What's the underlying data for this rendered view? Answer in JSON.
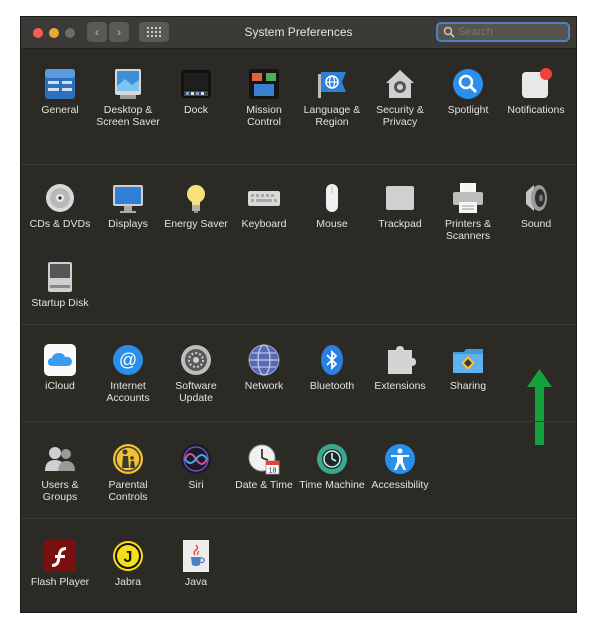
{
  "window": {
    "title": "System Preferences"
  },
  "search": {
    "placeholder": "Search"
  },
  "colors": {
    "accent": "#4b82c4",
    "arrow": "#14a03c",
    "bg": "#2c2a25"
  },
  "sections": [
    {
      "items": [
        {
          "label": "General",
          "icon": "general-icon"
        },
        {
          "label": "Desktop & Screen Saver",
          "icon": "desktop-icon"
        },
        {
          "label": "Dock",
          "icon": "dock-icon"
        },
        {
          "label": "Mission Control",
          "icon": "mission-control-icon"
        },
        {
          "label": "Language & Region",
          "icon": "language-icon"
        },
        {
          "label": "Security & Privacy",
          "icon": "security-icon"
        },
        {
          "label": "Spotlight",
          "icon": "spotlight-icon"
        },
        {
          "label": "Notifications",
          "icon": "notifications-icon"
        }
      ]
    },
    {
      "items": [
        {
          "label": "CDs & DVDs",
          "icon": "cd-icon"
        },
        {
          "label": "Displays",
          "icon": "displays-icon"
        },
        {
          "label": "Energy Saver",
          "icon": "energy-saver-icon"
        },
        {
          "label": "Keyboard",
          "icon": "keyboard-icon"
        },
        {
          "label": "Mouse",
          "icon": "mouse-icon"
        },
        {
          "label": "Trackpad",
          "icon": "trackpad-icon"
        },
        {
          "label": "Printers & Scanners",
          "icon": "printer-icon"
        },
        {
          "label": "Sound",
          "icon": "sound-icon"
        },
        {
          "label": "Startup Disk",
          "icon": "startup-disk-icon"
        }
      ]
    },
    {
      "items": [
        {
          "label": "iCloud",
          "icon": "icloud-icon"
        },
        {
          "label": "Internet Accounts",
          "icon": "internet-accounts-icon"
        },
        {
          "label": "Software Update",
          "icon": "software-update-icon"
        },
        {
          "label": "Network",
          "icon": "network-icon"
        },
        {
          "label": "Bluetooth",
          "icon": "bluetooth-icon"
        },
        {
          "label": "Extensions",
          "icon": "extensions-icon"
        },
        {
          "label": "Sharing",
          "icon": "sharing-icon"
        }
      ]
    },
    {
      "items": [
        {
          "label": "Users & Groups",
          "icon": "users-icon"
        },
        {
          "label": "Parental Controls",
          "icon": "parental-controls-icon"
        },
        {
          "label": "Siri",
          "icon": "siri-icon"
        },
        {
          "label": "Date & Time",
          "icon": "clock-icon"
        },
        {
          "label": "Time Machine",
          "icon": "time-machine-icon"
        },
        {
          "label": "Accessibility",
          "icon": "accessibility-icon"
        }
      ]
    },
    {
      "items": [
        {
          "label": "Flash Player",
          "icon": "flash-icon"
        },
        {
          "label": "Jabra",
          "icon": "jabra-icon"
        },
        {
          "label": "Java",
          "icon": "java-icon"
        }
      ]
    }
  ]
}
